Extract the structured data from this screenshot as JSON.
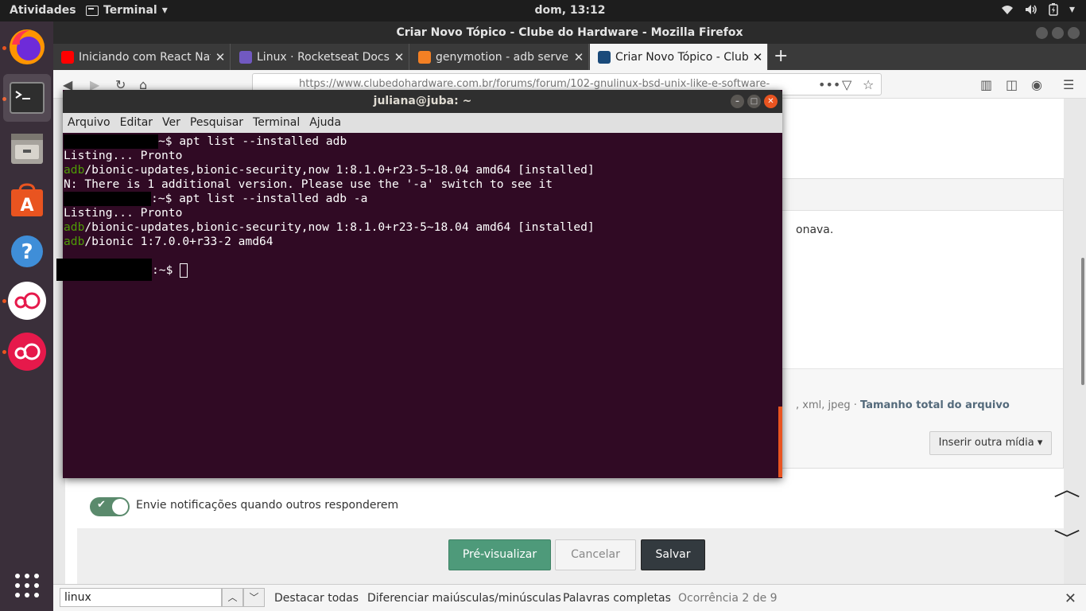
{
  "topbar": {
    "activities": "Atividades",
    "app_menu": "Terminal",
    "clock": "dom, 13:12"
  },
  "dock": {
    "items": [
      "firefox-icon",
      "terminal-icon",
      "files-icon",
      "software-center-icon",
      "help-icon",
      "genymotion-icon",
      "genymotion-icon"
    ]
  },
  "firefox": {
    "window_title": "Criar Novo Tópico - Clube do Hardware - Mozilla Firefox",
    "tabs": [
      {
        "title": "Iniciando com React Nati",
        "icon_color": "#ff0000",
        "active": false
      },
      {
        "title": "Linux · Rocketseat Docs",
        "icon_color": "#7159c1",
        "active": false
      },
      {
        "title": "genymotion - adb server",
        "icon_color": "#f48024",
        "active": false
      },
      {
        "title": "Criar Novo Tópico - Clube",
        "icon_color": "#1a4a7a",
        "active": true
      }
    ],
    "url": "https://www.clubedohardware.com.br/forums/forum/102-gnulinux-bsd-unix-like-e-software-",
    "page": {
      "editor_text": "onava.",
      "attach_text_plain": ", xml, jpeg · ",
      "attach_text_bold": "Tamanho total do arquivo",
      "insert_media": "Inserir outra mídia ▾",
      "notify_label": "Envie notificações quando outros responderem",
      "buttons": {
        "preview": "Pré-visualizar",
        "cancel": "Cancelar",
        "save": "Salvar"
      }
    },
    "findbar": {
      "query": "linux",
      "highlight_all": "Destacar todas",
      "match_case": "Diferenciar maiúsculas/minúsculas",
      "whole_words": "Palavras completas",
      "count": "Ocorrência 2 de 9"
    }
  },
  "terminal": {
    "title": "juliana@juba: ~",
    "menu": [
      "Arquivo",
      "Editar",
      "Ver",
      "Pesquisar",
      "Terminal",
      "Ajuda"
    ],
    "lines": {
      "l1_prompt": "~$ apt list --installed adb",
      "l2": "Listing... Pronto",
      "l3_pkg": "adb",
      "l3_rest": "/bionic-updates,bionic-security,now 1:8.1.0+r23-5~18.04 amd64 [installed]",
      "l4": "N: There is 1 additional version. Please use the '-a' switch to see it",
      "l5_prompt": ":~$ apt list --installed adb -a",
      "l6": "Listing... Pronto",
      "l7_pkg": "adb",
      "l7_rest": "/bionic-updates,bionic-security,now 1:8.1.0+r23-5~18.04 amd64 [installed]",
      "l8_pkg": "adb",
      "l8_rest": "/bionic 1:7.0.0+r33-2 amd64",
      "l9_prompt": ":~$ "
    }
  }
}
